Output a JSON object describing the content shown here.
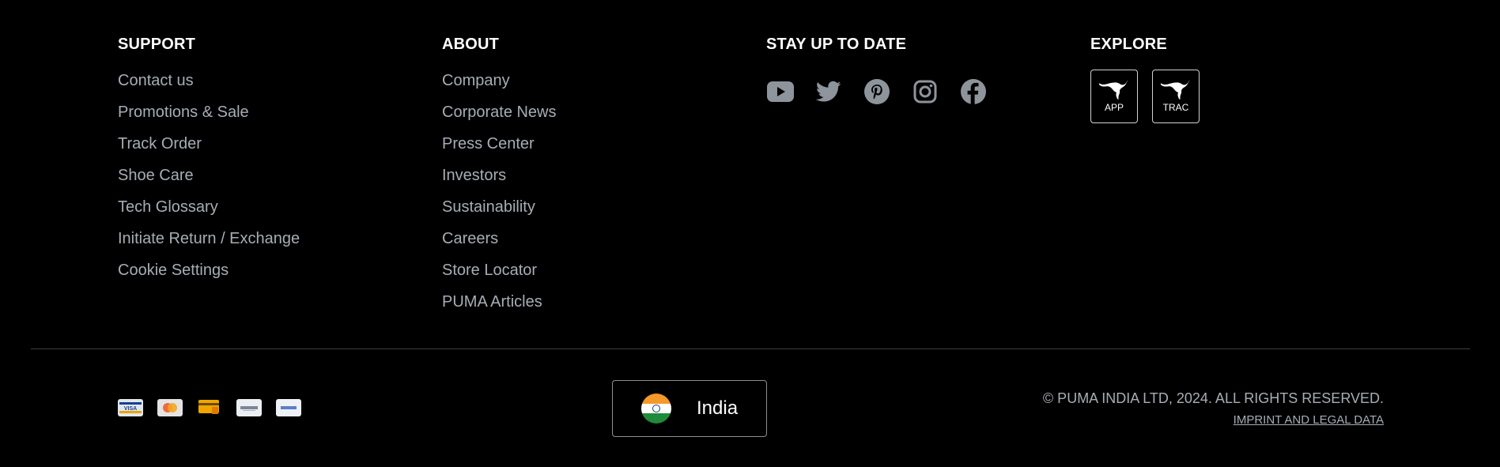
{
  "support": {
    "title": "SUPPORT",
    "links": [
      "Contact us",
      "Promotions & Sale",
      "Track Order",
      "Shoe Care",
      "Tech Glossary",
      "Initiate Return / Exchange",
      "Cookie Settings"
    ]
  },
  "about": {
    "title": "ABOUT",
    "links": [
      "Company",
      "Corporate News",
      "Press Center",
      "Investors",
      "Sustainability",
      "Careers",
      "Store Locator",
      "PUMA Articles"
    ]
  },
  "stay": {
    "title": "STAY UP TO DATE",
    "icons": [
      "youtube-icon",
      "twitter-icon",
      "pinterest-icon",
      "instagram-icon",
      "facebook-icon"
    ],
    "icon_color": "#8e949c"
  },
  "explore": {
    "title": "EXPLORE",
    "tiles": [
      {
        "label": "APP",
        "icon": "puma-cat-icon"
      },
      {
        "label": "TRAC",
        "icon": "puma-cat-icon"
      }
    ]
  },
  "payments": [
    "visa-icon",
    "mastercard-icon",
    "card-icon",
    "rupay-icon",
    "bhim-upi-icon"
  ],
  "country": {
    "name": "India",
    "flag": "india-flag-icon"
  },
  "legal": {
    "copyright": "© PUMA INDIA LTD, 2024. ALL RIGHTS RESERVED.",
    "imprint": "IMPRINT AND LEGAL DATA"
  }
}
